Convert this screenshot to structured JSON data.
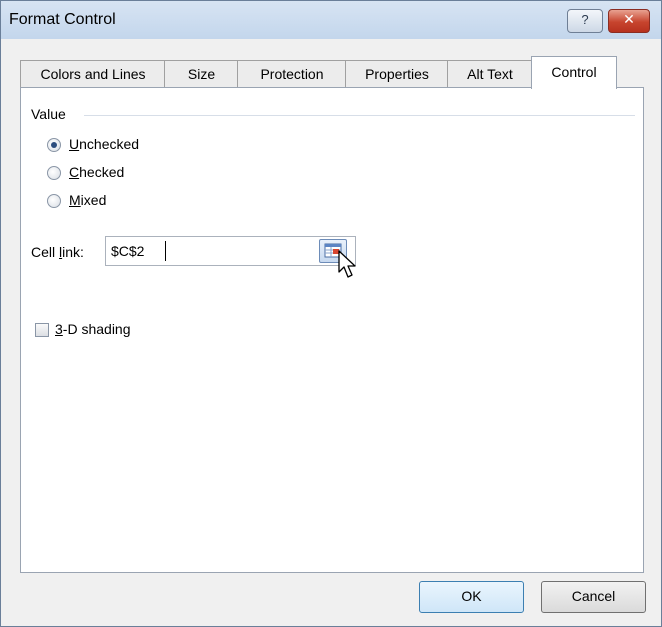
{
  "window": {
    "title": "Format Control",
    "help_button": "?",
    "close_button": "✕"
  },
  "tabs": [
    {
      "label": "Colors and Lines",
      "active": false
    },
    {
      "label": "Size",
      "active": false
    },
    {
      "label": "Protection",
      "active": false
    },
    {
      "label": "Properties",
      "active": false
    },
    {
      "label": "Alt Text",
      "active": false
    },
    {
      "label": "Control",
      "active": true
    }
  ],
  "value_group": {
    "label": "Value",
    "options": [
      {
        "accel": "U",
        "rest": "nchecked",
        "checked": true
      },
      {
        "accel": "C",
        "rest": "hecked",
        "checked": false
      },
      {
        "accel": "M",
        "rest": "ixed",
        "checked": false
      }
    ]
  },
  "cell_link": {
    "label_pre": "Cell ",
    "label_accel": "l",
    "label_post": "ink:",
    "value": "$C$2"
  },
  "shading": {
    "accel": "3",
    "rest": "-D shading",
    "checked": false
  },
  "buttons": {
    "ok": "OK",
    "cancel": "Cancel"
  },
  "icons": {
    "collapse_dialog": "collapse-dialog-icon",
    "cursor": "mouse-pointer-icon"
  }
}
